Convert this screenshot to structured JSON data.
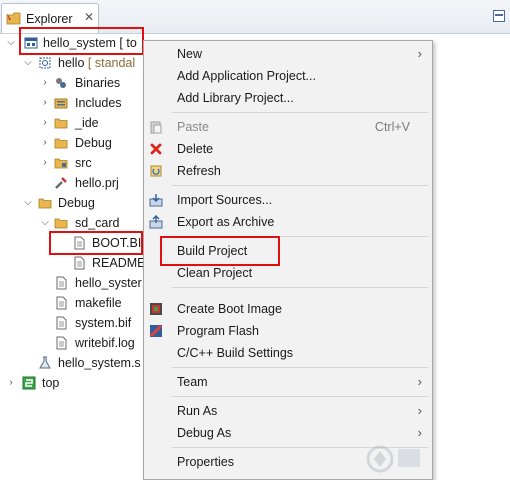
{
  "view": {
    "tab_label": "Explorer",
    "close_glyph": "✕"
  },
  "tree": {
    "items": [
      {
        "label": "hello_system [ to",
        "decor": ""
      },
      {
        "label": "hello",
        "decor": " [ standal"
      },
      {
        "label": "Binaries",
        "decor": ""
      },
      {
        "label": "Includes",
        "decor": ""
      },
      {
        "label": "_ide",
        "decor": ""
      },
      {
        "label": "Debug",
        "decor": ""
      },
      {
        "label": "src",
        "decor": ""
      },
      {
        "label": "hello.prj",
        "decor": ""
      },
      {
        "label": "Debug",
        "decor": ""
      },
      {
        "label": "sd_card",
        "decor": ""
      },
      {
        "label": "BOOT.BI",
        "decor": ""
      },
      {
        "label": "README",
        "decor": ""
      },
      {
        "label": "hello_syster",
        "decor": ""
      },
      {
        "label": "makefile",
        "decor": ""
      },
      {
        "label": "system.bif",
        "decor": ""
      },
      {
        "label": "writebif.log",
        "decor": ""
      },
      {
        "label": "hello_system.s",
        "decor": ""
      },
      {
        "label": "top",
        "decor": ""
      }
    ]
  },
  "menu": {
    "new": "New",
    "add_application_project": "Add Application Project...",
    "add_library_project": "Add Library Project...",
    "paste": "Paste",
    "paste_shortcut": "Ctrl+V",
    "delete": "Delete",
    "refresh": "Refresh",
    "import_sources": "Import Sources...",
    "export_archive": "Export as Archive",
    "build_project": "Build Project",
    "clean_project": "Clean Project",
    "create_boot_image": "Create Boot Image",
    "program_flash": "Program Flash",
    "cpp_build_settings": "C/C++ Build Settings",
    "team": "Team",
    "run_as": "Run As",
    "debug_as": "Debug As",
    "properties": "Properties",
    "submenu_arrow": "›"
  },
  "colors": {
    "highlight_box": "#e01010",
    "folder": "#e8b64c",
    "delete_red": "#d9261c"
  }
}
